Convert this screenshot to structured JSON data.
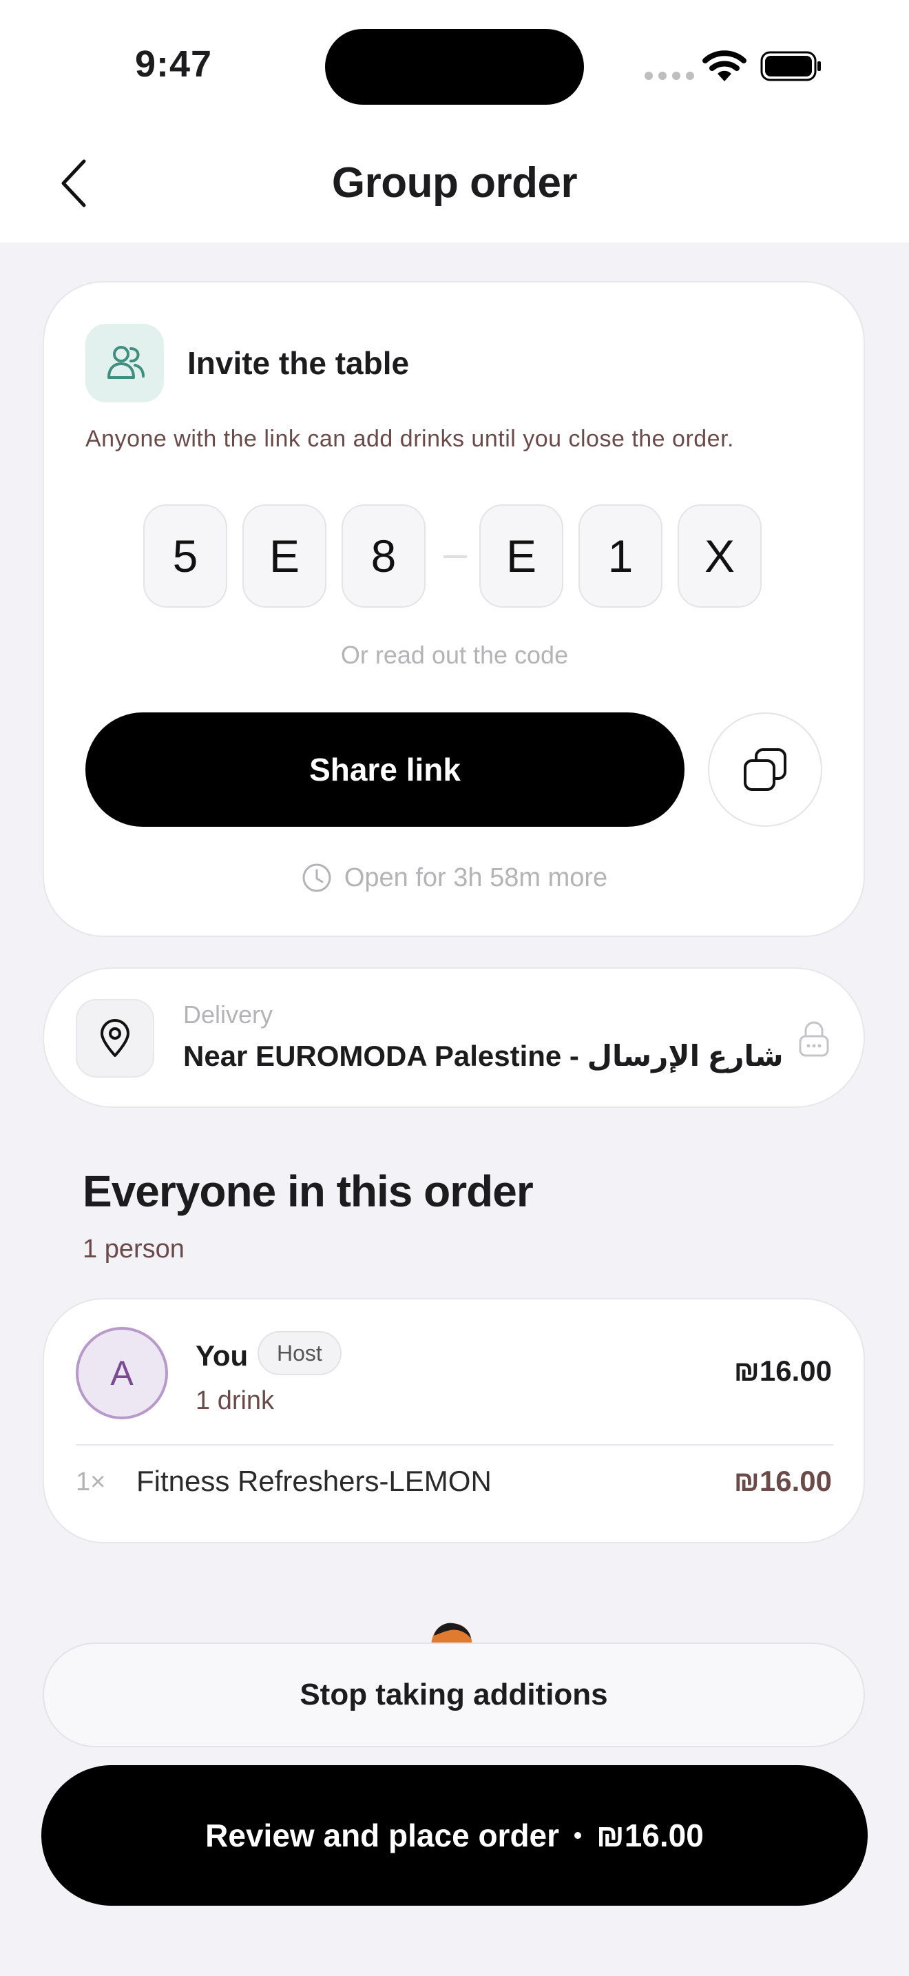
{
  "status_bar": {
    "time": "9:47"
  },
  "header": {
    "title": "Group order"
  },
  "invite": {
    "title": "Invite the table",
    "description": "Anyone with the link can add drinks until you close the order.",
    "code": [
      "5",
      "E",
      "8",
      "E",
      "1",
      "X"
    ],
    "code_hint": "Or read out the code",
    "share_label": "Share link",
    "open_text": "Open for 3h 58m more"
  },
  "delivery": {
    "label": "Delivery",
    "address": "Near EUROMODA Palestine - شارع الإرسال"
  },
  "participants": {
    "title": "Everyone in this order",
    "count": "1 person",
    "people": [
      {
        "initial": "A",
        "name": "You",
        "badge": "Host",
        "drinks": "1 drink",
        "total": "₪16.00",
        "items": [
          {
            "qty": "1×",
            "name": "Fitness Refreshers-LEMON",
            "price": "₪16.00"
          }
        ]
      }
    ]
  },
  "actions": {
    "stop_label": "Stop taking additions",
    "review_label": "Review and place order",
    "review_total": "₪16.00"
  },
  "colors": {
    "background": "#f2f2f7",
    "primary_button": "#000000",
    "invite_icon_bg": "#e3f1ee",
    "invite_icon": "#3f8f80",
    "avatar_border": "#b79ac9",
    "avatar_text": "#7c4a93",
    "secondary_text": "#6b4a4a",
    "muted_text": "#b3b3b8"
  }
}
